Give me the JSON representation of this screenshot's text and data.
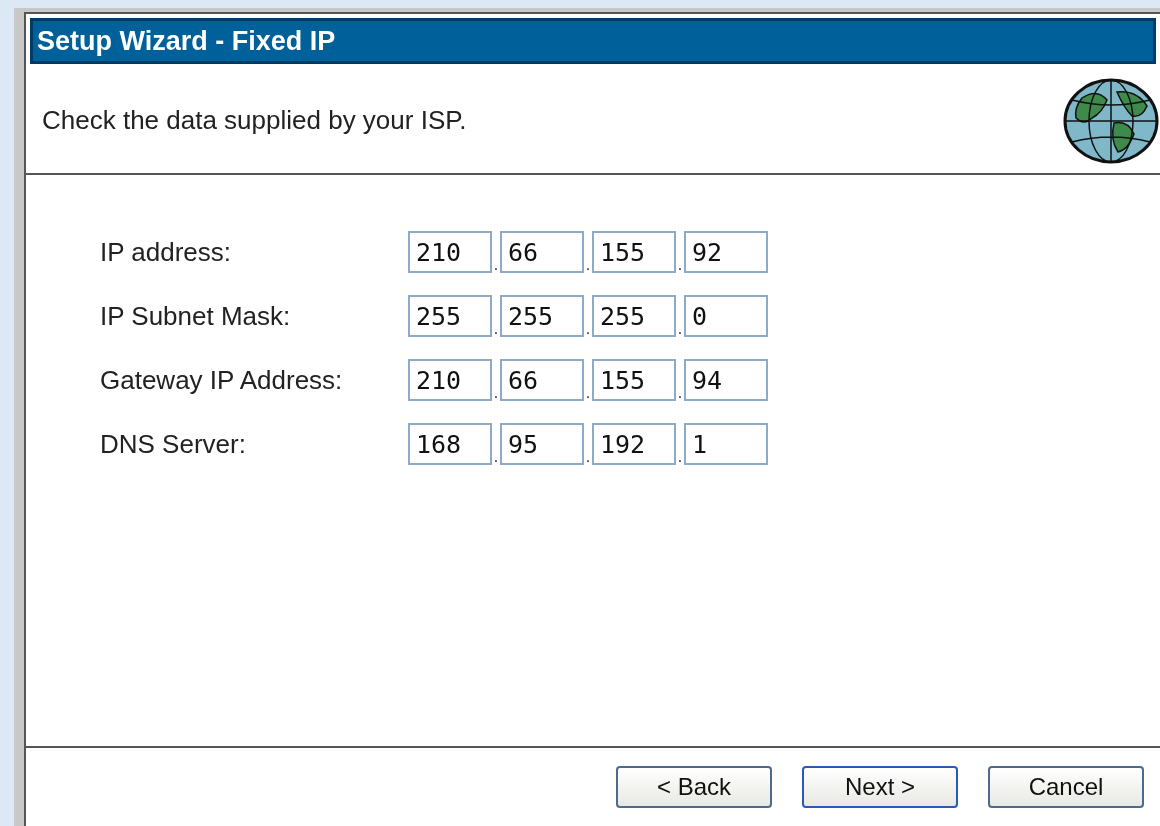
{
  "window": {
    "title": "Setup Wizard - Fixed IP"
  },
  "header": {
    "text": "Check the data supplied by your ISP."
  },
  "fields": [
    {
      "label": "IP address:",
      "octets": [
        "210",
        "66",
        "155",
        "92"
      ],
      "separators": [
        ".",
        ".",
        "."
      ]
    },
    {
      "label": "IP Subnet Mask:",
      "octets": [
        "255",
        "255",
        "255",
        "0"
      ],
      "separators": [
        ".",
        ".",
        "."
      ]
    },
    {
      "label": "Gateway IP Address:",
      "octets": [
        "210",
        "66",
        "155",
        "94"
      ],
      "separators": [
        ".",
        ".",
        "."
      ]
    },
    {
      "label": "DNS Server:",
      "octets": [
        "168",
        "95",
        "192",
        "1"
      ],
      "separators": [
        ".",
        ".",
        "."
      ]
    }
  ],
  "buttons": [
    {
      "label": "< Back",
      "default": false
    },
    {
      "label": "Next >",
      "default": true
    },
    {
      "label": "Cancel",
      "default": false
    }
  ]
}
